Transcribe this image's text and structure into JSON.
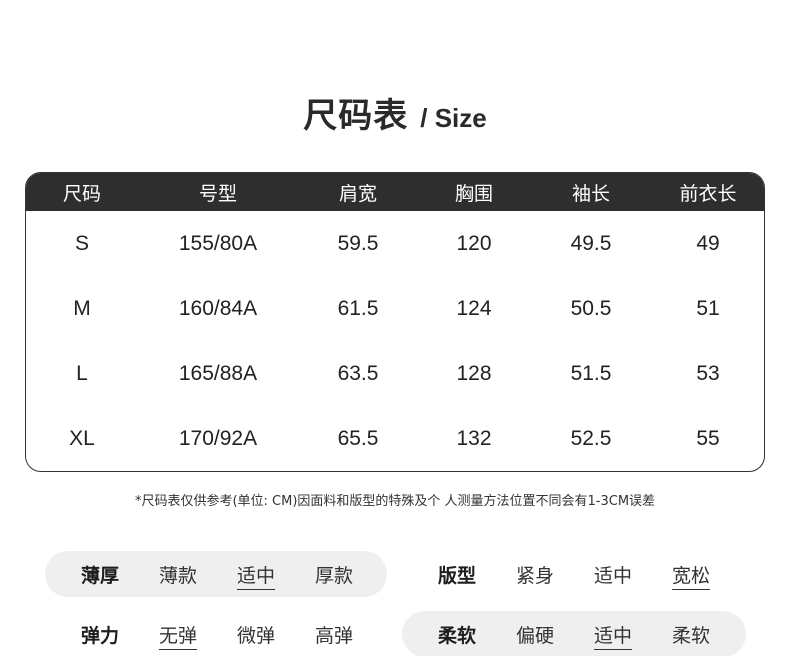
{
  "title": {
    "cn": "尺码表",
    "en": "/ Size"
  },
  "table": {
    "headers": [
      "尺码",
      "号型",
      "肩宽",
      "胸围",
      "袖长",
      "前衣长"
    ],
    "rows": [
      [
        "S",
        "155/80A",
        "59.5",
        "120",
        "49.5",
        "49"
      ],
      [
        "M",
        "160/84A",
        "61.5",
        "124",
        "50.5",
        "51"
      ],
      [
        "L",
        "165/88A",
        "63.5",
        "128",
        "51.5",
        "53"
      ],
      [
        "XL",
        "170/92A",
        "65.5",
        "132",
        "52.5",
        "55"
      ]
    ]
  },
  "note": "*尺码表仅供参考(单位: CM)因面料和版型的特殊及个 人测量方法位置不同会有1-3CM误差",
  "attributes": [
    {
      "label": "薄厚",
      "options": [
        "薄款",
        "适中",
        "厚款"
      ],
      "selected": 1
    },
    {
      "label": "版型",
      "options": [
        "紧身",
        "适中",
        "宽松"
      ],
      "selected": 2
    },
    {
      "label": "弹力",
      "options": [
        "无弹",
        "微弹",
        "高弹"
      ],
      "selected": 0
    },
    {
      "label": "柔软",
      "options": [
        "偏硬",
        "适中",
        "柔软"
      ],
      "selected": 1
    }
  ]
}
